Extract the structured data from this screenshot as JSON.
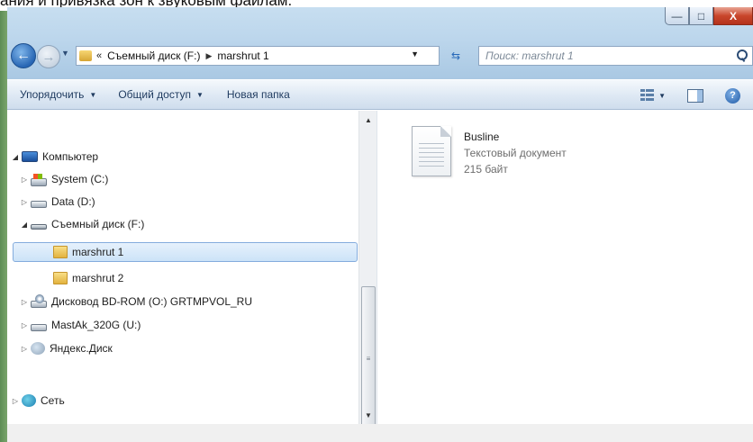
{
  "background_caption": "ания и привязка зон к звуковым файлам.",
  "window": {
    "controls": {
      "minimize": "—",
      "maximize": "□",
      "close": "X"
    }
  },
  "nav": {
    "back_icon": "back-arrow-icon",
    "forward_icon": "forward-arrow-icon",
    "address": {
      "chevron": "«",
      "crumbs": [
        "Съемный диск (F:)",
        "marshrut 1"
      ]
    },
    "search_placeholder": "Поиск: marshrut 1"
  },
  "toolbar": {
    "organize_label": "Упорядочить",
    "share_label": "Общий доступ",
    "new_folder_label": "Новая папка",
    "help_glyph": "?"
  },
  "tree": {
    "items": [
      {
        "label": "Компьютер",
        "icon": "computer-icon",
        "expanded": true
      },
      {
        "label": "System (C:)",
        "icon": "system-drive-icon"
      },
      {
        "label": "Data (D:)",
        "icon": "drive-icon"
      },
      {
        "label": "Съемный диск (F:)",
        "icon": "removable-drive-icon",
        "expanded": true
      },
      {
        "label": "marshrut 1",
        "icon": "folder-icon",
        "selected": true
      },
      {
        "label": "marshrut 2",
        "icon": "folder-icon"
      },
      {
        "label": "Дисковод BD-ROM (O:) GRTMPVOL_RU",
        "icon": "optical-drive-icon"
      },
      {
        "label": "MastAk_320G (U:)",
        "icon": "drive-icon"
      },
      {
        "label": "Яндекс.Диск",
        "icon": "yandex-disk-icon"
      },
      {
        "label": "Сеть",
        "icon": "network-icon"
      }
    ]
  },
  "content": {
    "file": {
      "name": "Busline",
      "type": "Текстовый документ",
      "size": "215 байт",
      "icon": "text-document-icon"
    }
  },
  "colors": {
    "title_gradient_top": "#c7def0",
    "toolbar_text": "#1e3a5f",
    "selection_border": "#84acdd"
  }
}
